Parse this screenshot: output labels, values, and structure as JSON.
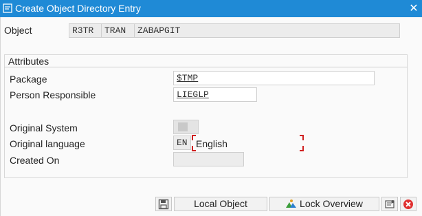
{
  "window": {
    "title": "Create Object Directory Entry",
    "close_symbol": "✕"
  },
  "object": {
    "label": "Object",
    "program_id": "R3TR",
    "object_type": "TRAN",
    "object_name": "ZABAPGIT"
  },
  "attributes": {
    "title": "Attributes",
    "package_label": "Package",
    "package_value": "$TMP",
    "person_label": "Person Responsible",
    "person_value": "LIEGLP",
    "orig_system_label": "Original System",
    "orig_system_value": "",
    "orig_language_label": "Original language",
    "orig_language_code": "EN",
    "orig_language_name": "English",
    "created_on_label": "Created On",
    "created_on_value": ""
  },
  "toolbar": {
    "save_icon": "floppy-disk-icon",
    "local_object_label": "Local Object",
    "lock_overview_label": "Lock Overview",
    "cancel_icon": "cancel-icon"
  },
  "colors": {
    "titlebar": "#1f8ad6",
    "field_bg": "#ececec",
    "required_marker": "#d02020",
    "cancel_red": "#e03030"
  }
}
